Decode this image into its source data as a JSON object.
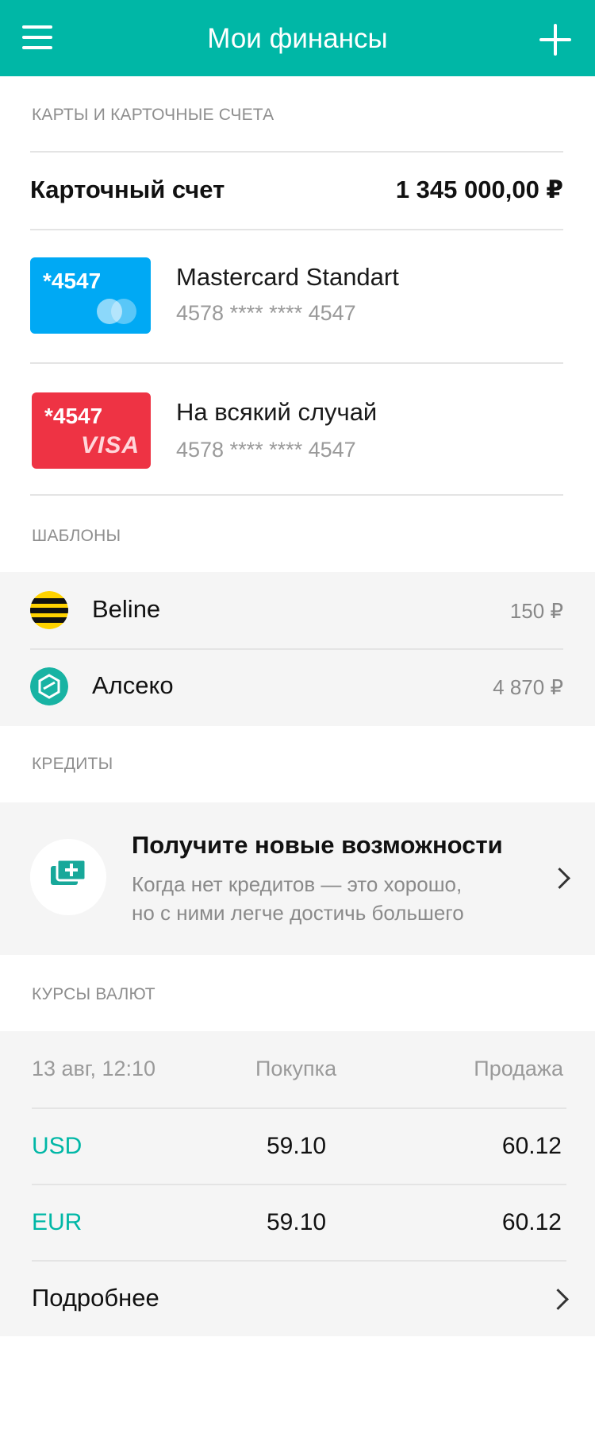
{
  "header": {
    "title": "Мои финансы",
    "menu_icon": "hamburger-icon",
    "add_icon": "plus-icon"
  },
  "cards_section": {
    "label": "КАРТЫ И КАРТОЧНЫЕ СЧЕТА",
    "account": {
      "label": "Карточный счет",
      "amount": "1 345 000,00 ₽"
    },
    "cards": [
      {
        "thumb_number": "*4547",
        "name": "Mastercard Standart",
        "number": "4578 **** **** 4547",
        "brand": "mastercard",
        "color": "#00a9f4"
      },
      {
        "thumb_number": "*4547",
        "name": "На всякий случай",
        "number": "4578 **** **** 4547",
        "brand": "VISA",
        "color": "#ee3344"
      }
    ]
  },
  "templates_section": {
    "label": "ШАБЛОНЫ",
    "items": [
      {
        "name": "Beline",
        "amount": "150 ₽",
        "icon": "beeline-logo-icon"
      },
      {
        "name": "Алсеко",
        "amount": "4 870 ₽",
        "icon": "alseko-logo-icon"
      }
    ]
  },
  "credits_section": {
    "label": "КРЕДИТЫ",
    "promo": {
      "title": "Получите новые возможности",
      "line1": "Когда нет кредитов — это хорошо,",
      "line2": "но с ними легче достичь большего",
      "icon": "add-card-icon"
    }
  },
  "rates_section": {
    "label": "КУРСЫ ВАЛЮТ",
    "date": "13 авг, 12:10",
    "buy_header": "Покупка",
    "sell_header": "Продажа",
    "rows": [
      {
        "currency": "USD",
        "buy": "59.10",
        "sell": "60.12"
      },
      {
        "currency": "EUR",
        "buy": "59.10",
        "sell": "60.12"
      }
    ],
    "more_label": "Подробнее"
  },
  "colors": {
    "accent": "#00b7a6",
    "gray_band": "#f5f5f5"
  }
}
